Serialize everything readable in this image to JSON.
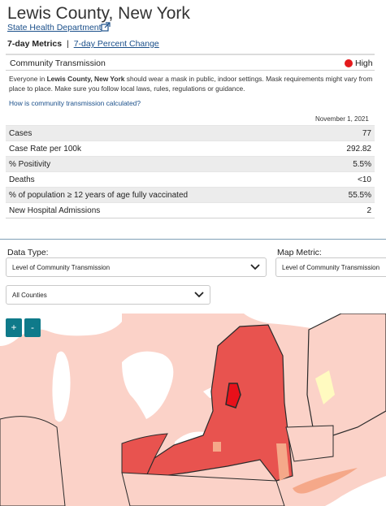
{
  "header": {
    "title": "Lewis County, New York",
    "source_link": "State Health Department",
    "source_icon": "external-link-icon"
  },
  "tabs": {
    "active": "7-day Metrics",
    "separator": "|",
    "other": "7-day Percent Change"
  },
  "transmission": {
    "label": "Community Transmission",
    "level": "High",
    "level_color": "#e41a1c",
    "desc_prefix": "Everyone in ",
    "desc_bold": "Lewis County, New York",
    "desc_suffix": " should wear a mask in public, indoor settings. Mask requirements might vary from place to place. Make sure you follow local laws, rules, regulations or guidance.",
    "calc_link": "How is community transmission calculated?"
  },
  "metrics": {
    "date": "November 1, 2021",
    "rows": [
      {
        "label": "Cases",
        "value": "77"
      },
      {
        "label": "Case Rate per 100k",
        "value": "292.82"
      },
      {
        "label": "% Positivity",
        "value": "5.5%"
      },
      {
        "label": "Deaths",
        "value": "<10"
      },
      {
        "label": "% of population ≥ 12 years of age fully vaccinated",
        "value": "55.5%"
      },
      {
        "label": "New Hospital Admissions",
        "value": "2"
      }
    ]
  },
  "controls": {
    "data_type_label": "Data Type:",
    "data_type_value": "Level of Community Transmission",
    "map_metric_label": "Map Metric:",
    "map_metric_value": "Level of Community Transmission",
    "counties_value": "All Counties",
    "zoom_in": "+",
    "zoom_out": "-"
  },
  "map_colors": {
    "high": "#e8534f",
    "highlight": "#e8101a",
    "substantial": "#f5a889",
    "moderate": "#fbd2c8",
    "low": "#fffac0",
    "border": "#2a2a2a",
    "water": "#ffffff"
  }
}
